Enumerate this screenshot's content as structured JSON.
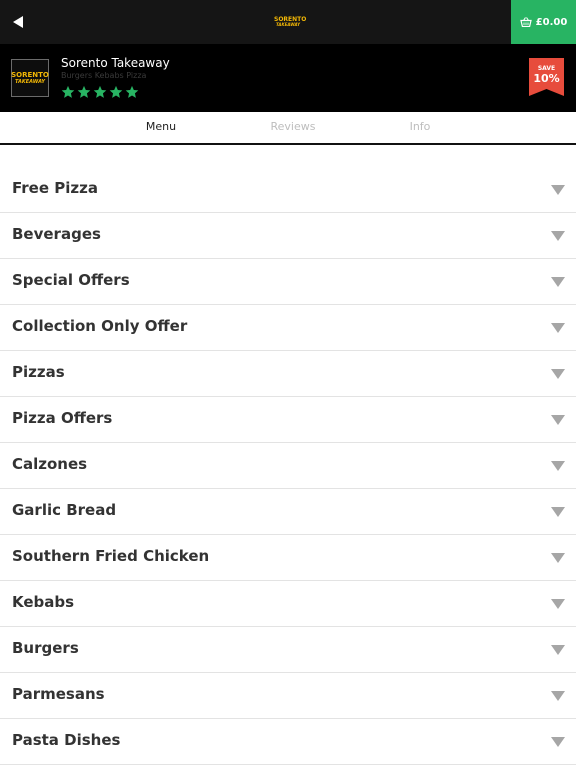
{
  "topbar": {
    "back_icon": "back-triangle-icon",
    "logo": {
      "line1": "SORENTO",
      "line2": "TAKEAWAY"
    },
    "basket": {
      "icon": "basket-icon",
      "amount": "£0.00",
      "color": "#28b463"
    }
  },
  "restaurant": {
    "logo": {
      "line1": "SORENTO",
      "line2": "TAKEAWAY"
    },
    "name": "Sorento Takeaway",
    "cuisines": "Burgers Kebabs Pizza",
    "rating_stars": 5,
    "star_color": "#28b463",
    "badge": {
      "label": "SAVE",
      "percent": "10%",
      "color": "#e74c3c"
    }
  },
  "tabs": [
    {
      "label": "Menu",
      "active": true
    },
    {
      "label": "Reviews",
      "active": false
    },
    {
      "label": "Info",
      "active": false
    }
  ],
  "categories": [
    "Free Pizza",
    "Beverages",
    "Special Offers",
    "Collection Only Offer",
    "Pizzas",
    "Pizza Offers",
    "Calzones",
    "Garlic Bread",
    "Southern Fried Chicken",
    "Kebabs",
    "Burgers",
    "Parmesans",
    "Pasta Dishes"
  ]
}
